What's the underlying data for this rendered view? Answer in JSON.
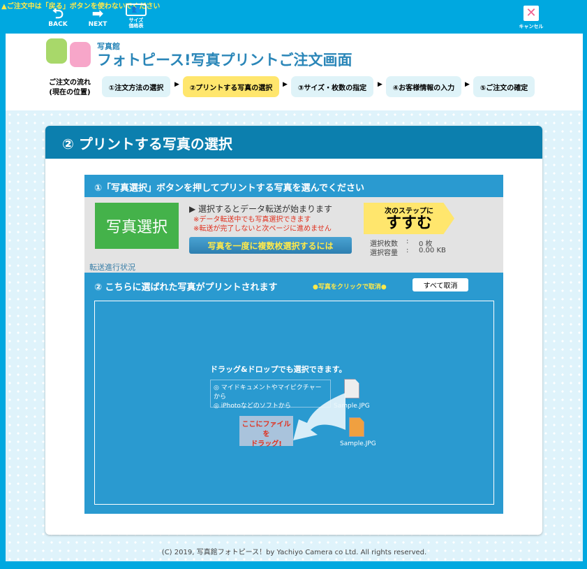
{
  "topbar": {
    "warning": "▲ご注文中は「戻る」ボタンを使わないでください",
    "back": "BACK",
    "next": "NEXT",
    "size_line1": "サイズ",
    "size_line2": "価格表",
    "cancel": "キャンセル"
  },
  "header": {
    "logo_small": "写真館",
    "logo_title": "フォトピース!写真プリントご注文画面",
    "flow_label_1": "ご注文の流れ",
    "flow_label_2": "(現在の位置)",
    "steps": [
      "①注文方法の選択",
      "②プリントする写真の選択",
      "③サイズ・枚数の指定",
      "④お客様情報の入力",
      "⑤ご注文の確定"
    ],
    "active_step": 2
  },
  "main": {
    "title": "② プリントする写真の選択",
    "section1_title": "①「写真選択」ボタンを押してプリントする写真を選んでください",
    "select_button": "写真選択",
    "info_main": "▶ 選択するとデータ転送が始まります",
    "info_red1": "※データ転送中でも写真選択できます",
    "info_red2": "※転送が完了しないと次ページに進めません",
    "multi_button": "写真を一度に複数枚選択するには",
    "next_small": "次のステップに",
    "next_big": "すすむ",
    "count_label": "選択枚数",
    "count_value": "0 枚",
    "size_label": "選択容量",
    "size_value": "0.00 KB",
    "sep": ":",
    "transfer_status": "転送進行状況",
    "section2_title": "② こちらに選ばれた写真がプリントされます",
    "click_cancel": "●写真をクリックで取消●",
    "clear_all": "すべて取消",
    "dnd_title": "ドラッグ&ドロップでも選択できます。",
    "dnd_opt1": "◎ マイドキュメントやマイピクチャーから",
    "dnd_opt2": "◎ iPhotoなどのソフトから",
    "drag_here_1": "ここにファイルを",
    "drag_here_2": "ドラッグ!",
    "file1": "Sample.JPG",
    "file2": "Sample.JPG"
  },
  "footer": "(C) 2019, 写真館フォトピース！by Yachiyo Camera co Ltd. All rights reserved.",
  "colors": {
    "brand": "#00a8e0",
    "title_bar": "#0c7fae",
    "active_step": "#ffe66d",
    "select_green": "#44b24a"
  }
}
